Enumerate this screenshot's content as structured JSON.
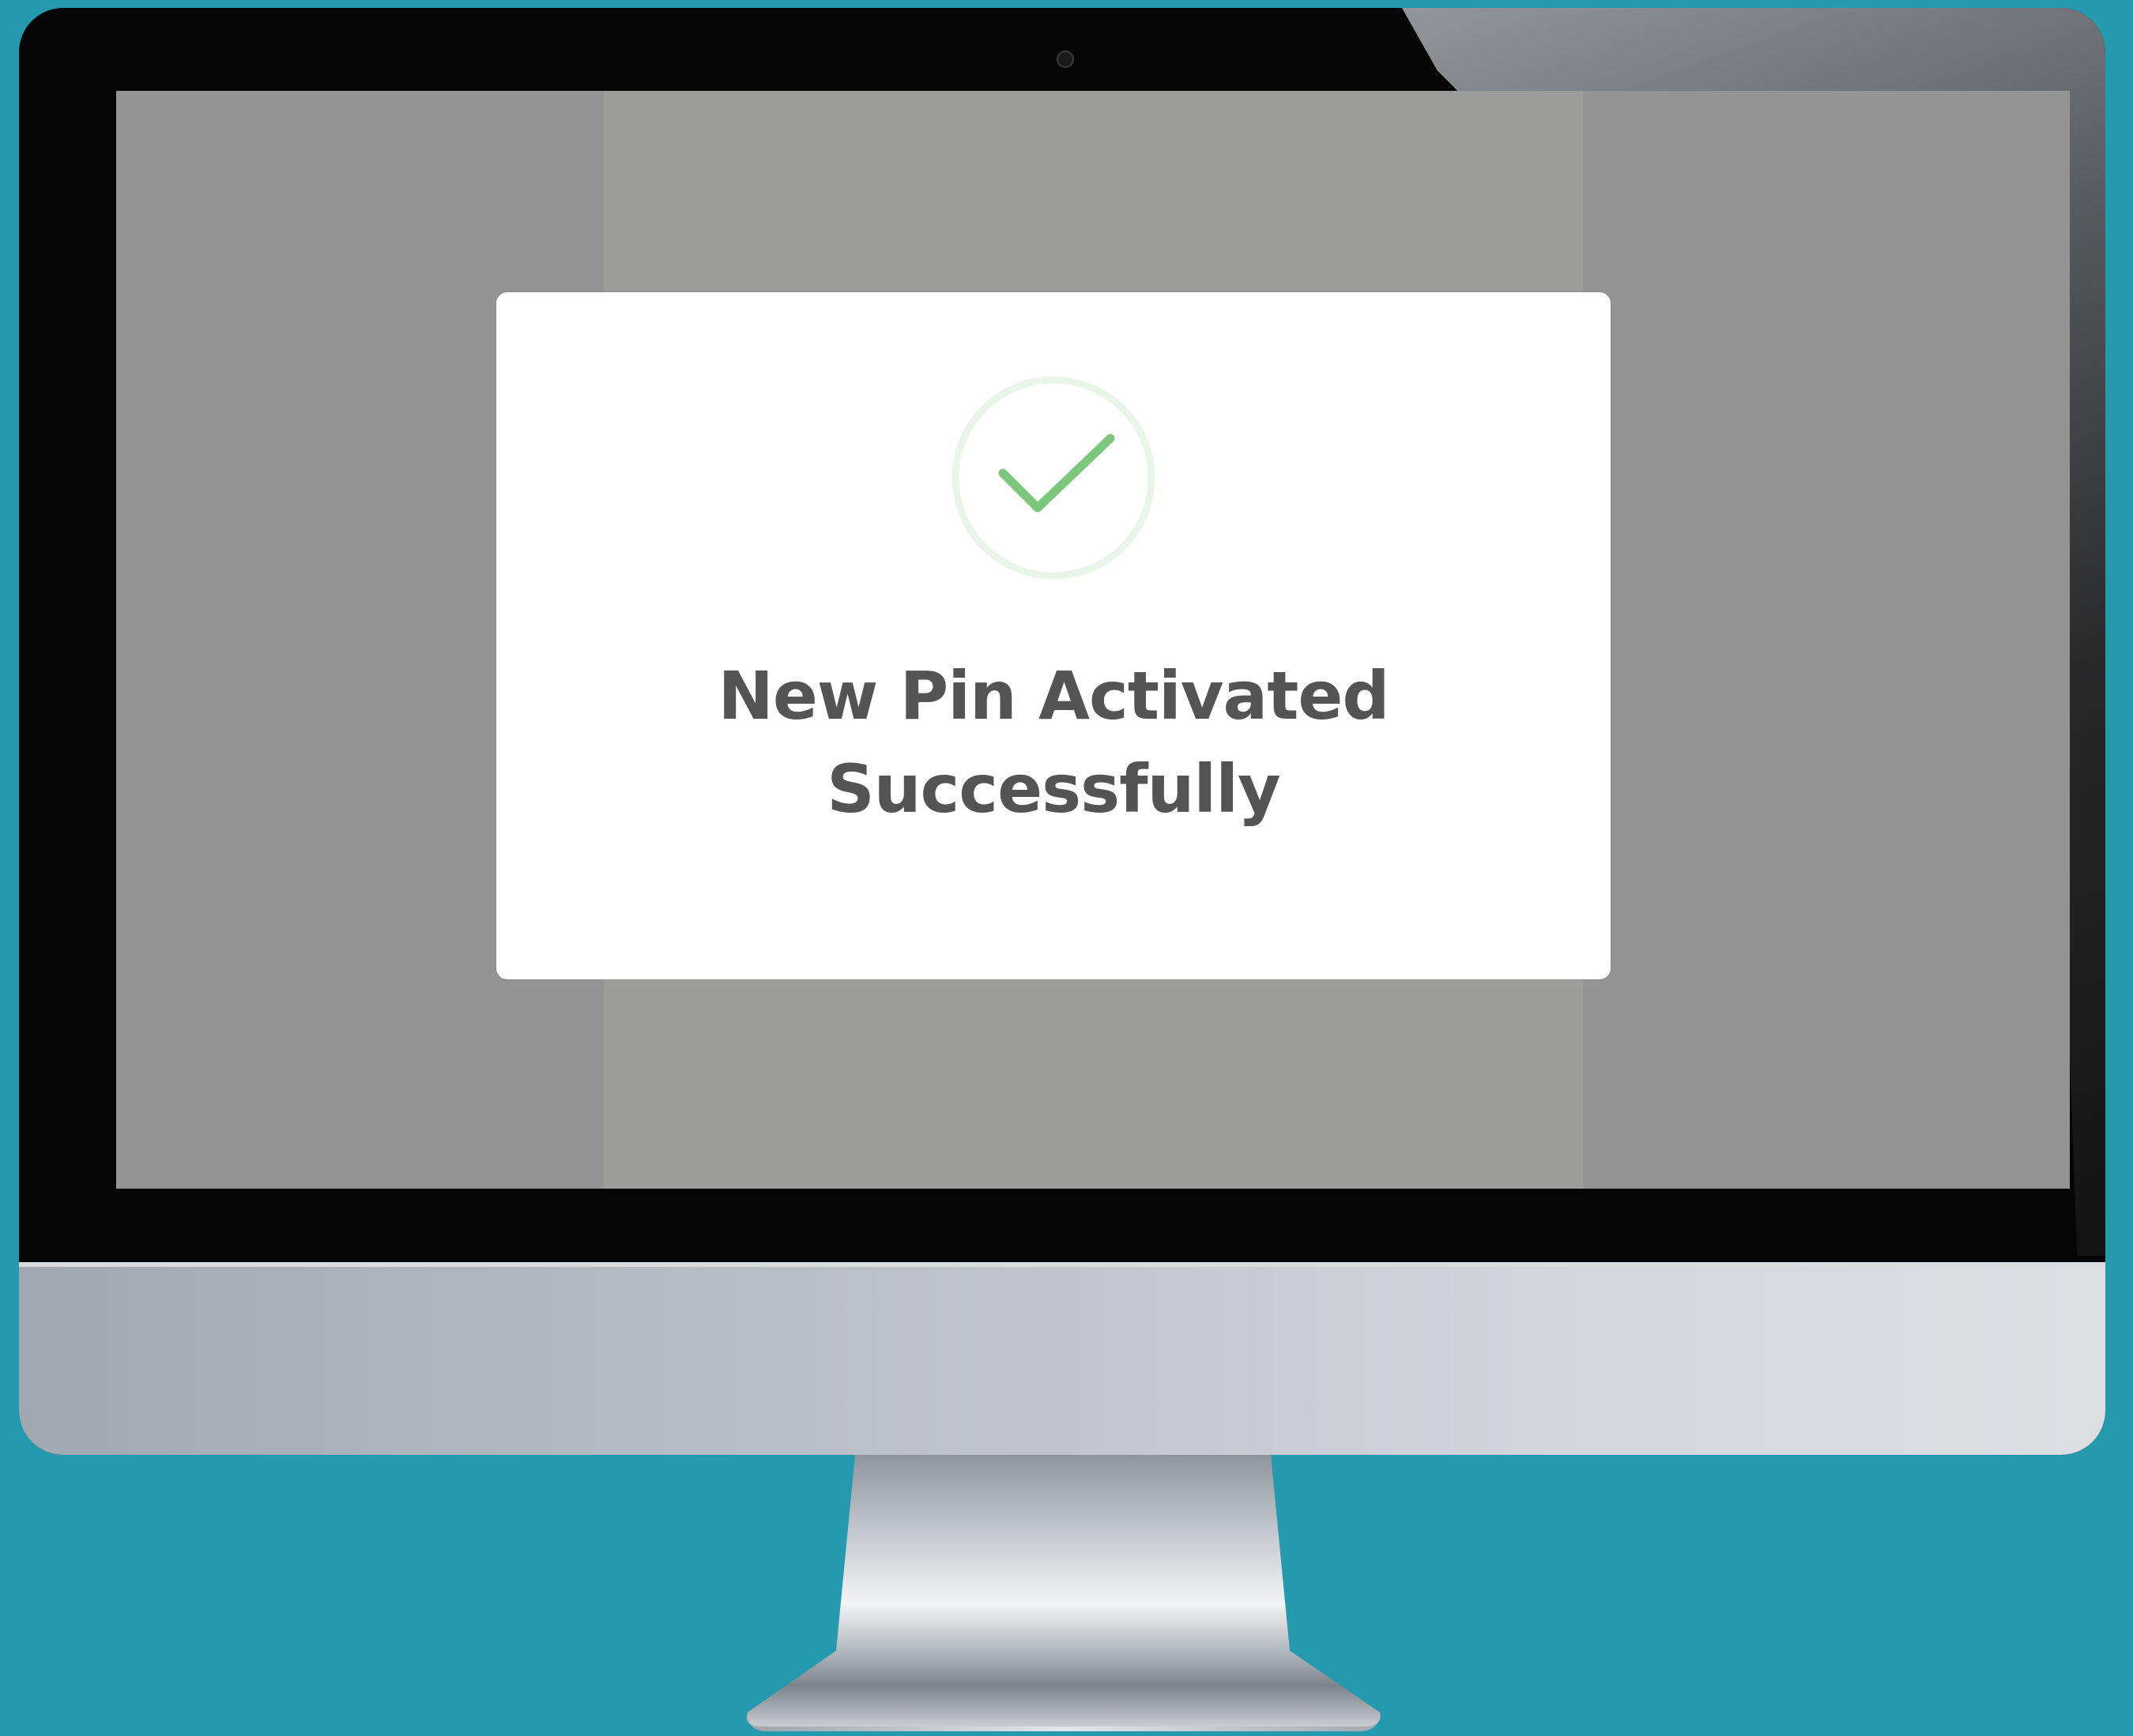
{
  "modal": {
    "title_line1": "New Pin Activated",
    "title_line2": "Successfully",
    "icon": "check-circle-icon"
  },
  "colors": {
    "background": "#259aae",
    "screen_dim": "#949494",
    "check_green": "#7bc77b",
    "title_text": "#545454"
  }
}
